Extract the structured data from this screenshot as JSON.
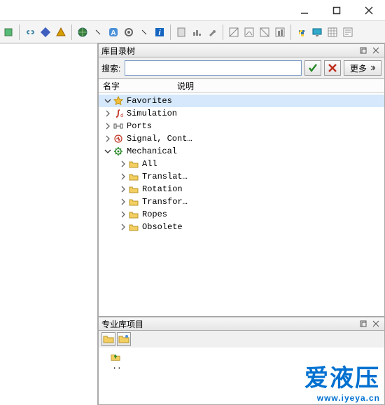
{
  "windowControls": {
    "minimize": "—",
    "maximize": "☐",
    "close": "✕"
  },
  "panels": {
    "tree": {
      "title": "库目录树"
    },
    "library": {
      "title": "专业库项目"
    }
  },
  "search": {
    "label": "搜索:",
    "placeholder": "",
    "value": "",
    "more": "更多"
  },
  "treeColumns": {
    "name": "名字",
    "desc": "说明"
  },
  "treeNodes": [
    {
      "label": "Favorites",
      "depth": 0,
      "icon": "star",
      "exp": "down",
      "sel": true
    },
    {
      "label": "Simulation",
      "depth": 0,
      "icon": "integral",
      "exp": "right",
      "sel": false
    },
    {
      "label": "Ports",
      "depth": 0,
      "icon": "ports",
      "exp": "right",
      "sel": false
    },
    {
      "label": "Signal, Cont…",
      "depth": 0,
      "icon": "signal",
      "exp": "right",
      "sel": false
    },
    {
      "label": "Mechanical",
      "depth": 0,
      "icon": "gear",
      "exp": "down",
      "sel": false
    },
    {
      "label": "All",
      "depth": 1,
      "icon": "folder",
      "exp": "right",
      "sel": false
    },
    {
      "label": "Translat…",
      "depth": 1,
      "icon": "folder",
      "exp": "right",
      "sel": false
    },
    {
      "label": "Rotation",
      "depth": 1,
      "icon": "folder",
      "exp": "right",
      "sel": false
    },
    {
      "label": "Transfor…",
      "depth": 1,
      "icon": "folder",
      "exp": "right",
      "sel": false
    },
    {
      "label": "Ropes",
      "depth": 1,
      "icon": "folder",
      "exp": "right",
      "sel": false
    },
    {
      "label": "Obsolete",
      "depth": 1,
      "icon": "folder",
      "exp": "right",
      "sel": false
    }
  ],
  "bottomItems": [
    {
      "label": "..",
      "icon": "folder-up"
    }
  ],
  "watermark": {
    "big": "爱液压",
    "small": "www.iyeya.cn"
  },
  "toolbarIcons": [
    "cube",
    "link",
    "diamond",
    "cone",
    "sep",
    "globe",
    "app",
    "gear2",
    "info",
    "sep",
    "doc1",
    "chart",
    "tool",
    "sep",
    "box1",
    "box2",
    "box3",
    "box4",
    "sep",
    "python",
    "monitor",
    "grid",
    "text"
  ]
}
